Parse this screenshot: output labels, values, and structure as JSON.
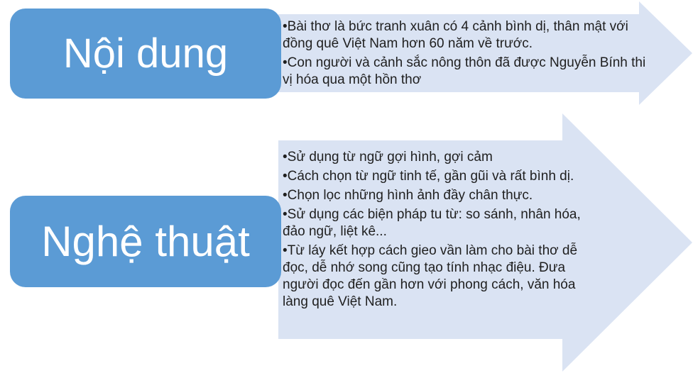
{
  "colors": {
    "box_fill": "#5b9bd5",
    "arrow_fill": "#dae3f3",
    "box_text": "#ffffff",
    "body_text": "#1f1f1f"
  },
  "rows": [
    {
      "title": "Nội dung",
      "bullets": [
        "Bài thơ là bức tranh xuân có 4 cảnh bình dị, thân mật với đồng quê Việt Nam hơn 60 năm về trước.",
        "Con người và cảnh sắc nông thôn đã được Nguyễn Bính thi vị hóa qua một hồn thơ"
      ]
    },
    {
      "title": "Nghệ thuật",
      "bullets": [
        "Sử dụng từ ngữ gợi hình, gợi cảm",
        "Cách chọn từ ngữ tinh tế, gần gũi và rất bình dị.",
        "Chọn lọc những hình ảnh đầy chân thực.",
        "Sử dụng các biện pháp tu từ: so sánh, nhân hóa, đảo ngữ, liệt kê...",
        "Từ láy kết hợp cách gieo vần làm cho bài thơ dễ đọc, dễ nhớ song cũng tạo tính nhạc điệu. Đưa người đọc đến gần hơn với phong cách, văn hóa làng quê Việt Nam."
      ]
    }
  ]
}
